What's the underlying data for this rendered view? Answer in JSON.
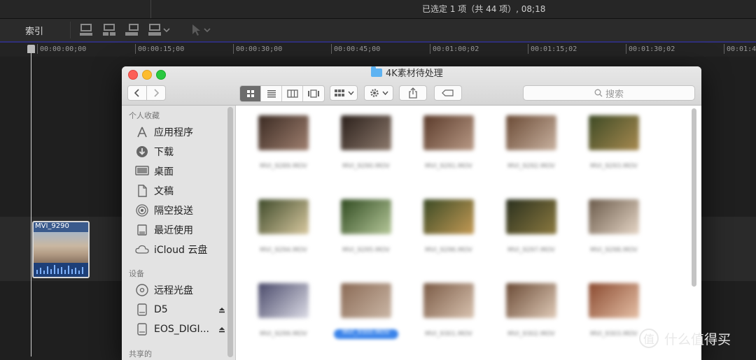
{
  "app": {
    "status_text": "已选定 1 项（共 44 项）, 08;18",
    "index_label": "索引",
    "timecodes": [
      "00:00:00;00",
      "00:00:15;00",
      "00:00:30;00",
      "00:00:45;00",
      "00:01:00;02",
      "00:01:15;02",
      "00:01:30;02",
      "00:01:4"
    ],
    "clip": {
      "name": "MVI_9290"
    }
  },
  "finder": {
    "title": "4K素材待处理",
    "search_placeholder": "搜索",
    "view_modes": [
      "icon-view",
      "list-view",
      "column-view",
      "coverflow-view"
    ],
    "selected_view": "icon-view",
    "sidebar": {
      "favorites_header": "个人收藏",
      "favorites": [
        {
          "label": "应用程序",
          "icon": "applications-icon"
        },
        {
          "label": "下载",
          "icon": "download-icon"
        },
        {
          "label": "桌面",
          "icon": "desktop-icon"
        },
        {
          "label": "文稿",
          "icon": "documents-icon"
        },
        {
          "label": "隔空投送",
          "icon": "airdrop-icon"
        },
        {
          "label": "最近使用",
          "icon": "recents-icon"
        },
        {
          "label": "iCloud 云盘",
          "icon": "icloud-icon"
        }
      ],
      "devices_header": "设备",
      "devices": [
        {
          "label": "远程光盘",
          "icon": "disc-icon",
          "eject": false
        },
        {
          "label": "D5",
          "icon": "drive-icon",
          "eject": true
        },
        {
          "label": "EOS_DIGI...",
          "icon": "drive-icon",
          "eject": true
        }
      ],
      "shared_header": "共享的"
    },
    "files": [
      {
        "name": "MVI_9289.MOV",
        "colors": [
          "#3a2a22",
          "#a08070"
        ],
        "selected": false
      },
      {
        "name": "MVI_9290.MOV",
        "colors": [
          "#2a1f1a",
          "#8d7a6d"
        ],
        "selected": false
      },
      {
        "name": "MVI_9291.MOV",
        "colors": [
          "#5a3a2a",
          "#b99a86"
        ],
        "selected": false
      },
      {
        "name": "MVI_9292.MOV",
        "colors": [
          "#6a4a35",
          "#c9b2a0"
        ],
        "selected": false
      },
      {
        "name": "MVI_9293.MOV",
        "colors": [
          "#3d4a25",
          "#a88a50"
        ],
        "selected": false
      },
      {
        "name": "MVI_9294.MOV",
        "colors": [
          "#3e4a2a",
          "#d9c9a0"
        ],
        "selected": false
      },
      {
        "name": "MVI_9295.MOV",
        "colors": [
          "#2f4a20",
          "#b6c89a"
        ],
        "selected": false
      },
      {
        "name": "MVI_9296.MOV",
        "colors": [
          "#3a4a25",
          "#c49a55"
        ],
        "selected": false
      },
      {
        "name": "MVI_9297.MOV",
        "colors": [
          "#2a301e",
          "#8c7a40"
        ],
        "selected": false
      },
      {
        "name": "MVI_9298.MOV",
        "colors": [
          "#6a5a4a",
          "#e6d6c6"
        ],
        "selected": false
      },
      {
        "name": "MVI_9299.MOV",
        "colors": [
          "#4a4a6a",
          "#dcdce6"
        ],
        "selected": false
      },
      {
        "name": "MVI_9300.MOV",
        "colors": [
          "#8a6a55",
          "#cbb7a6"
        ],
        "selected": true
      },
      {
        "name": "MVI_9301.MOV",
        "colors": [
          "#7a5a45",
          "#d9c3b0"
        ],
        "selected": false
      },
      {
        "name": "MVI_9302.MOV",
        "colors": [
          "#6a4a35",
          "#e0cbb8"
        ],
        "selected": false
      },
      {
        "name": "MVI_9303.MOV",
        "colors": [
          "#8a4a30",
          "#e6c0a6"
        ],
        "selected": false
      }
    ]
  },
  "watermark": {
    "text": "什么值得买",
    "symbol": "值"
  }
}
